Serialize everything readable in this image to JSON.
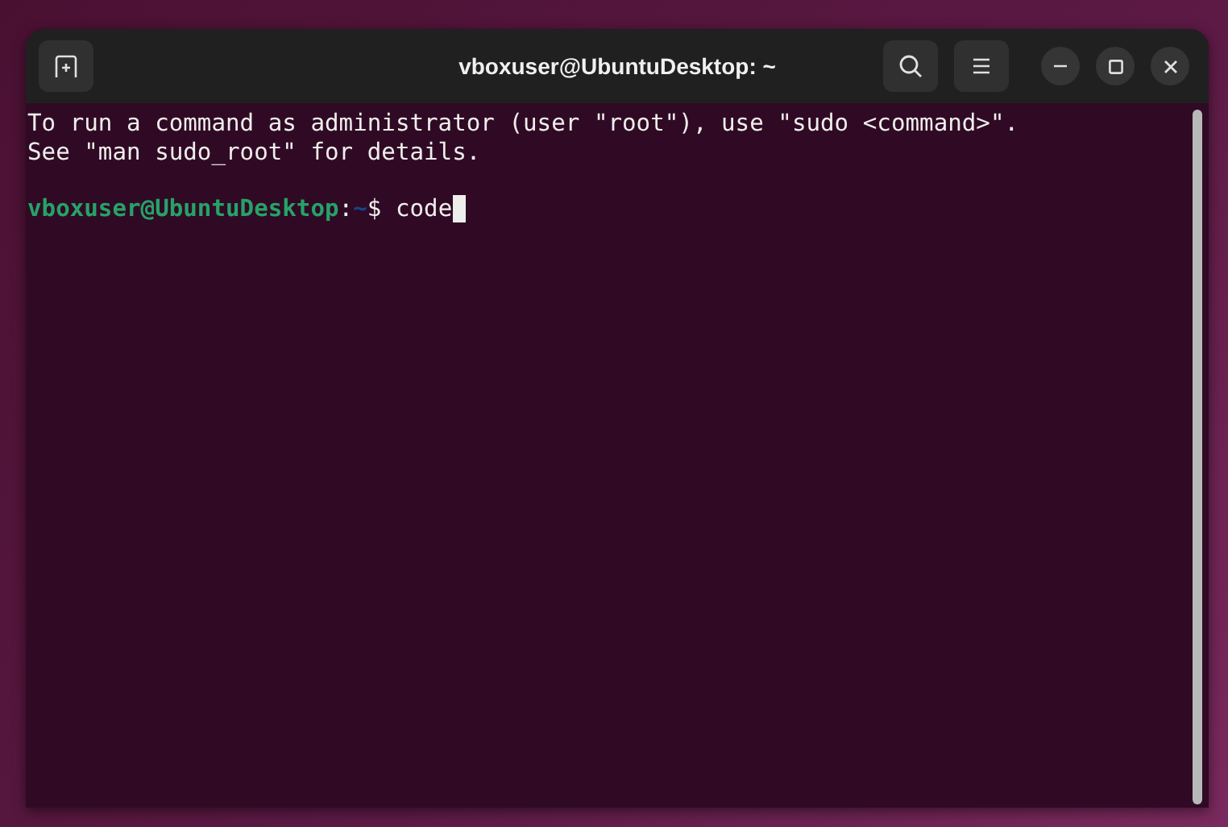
{
  "window": {
    "title": "vboxuser@UbuntuDesktop: ~"
  },
  "terminal": {
    "output": [
      "To run a command as administrator (user \"root\"), use \"sudo <command>\".",
      "See \"man sudo_root\" for details."
    ],
    "prompt": {
      "user_host": "vboxuser@UbuntuDesktop",
      "separator": ":",
      "path": "~",
      "symbol": "$",
      "command": "code"
    }
  }
}
